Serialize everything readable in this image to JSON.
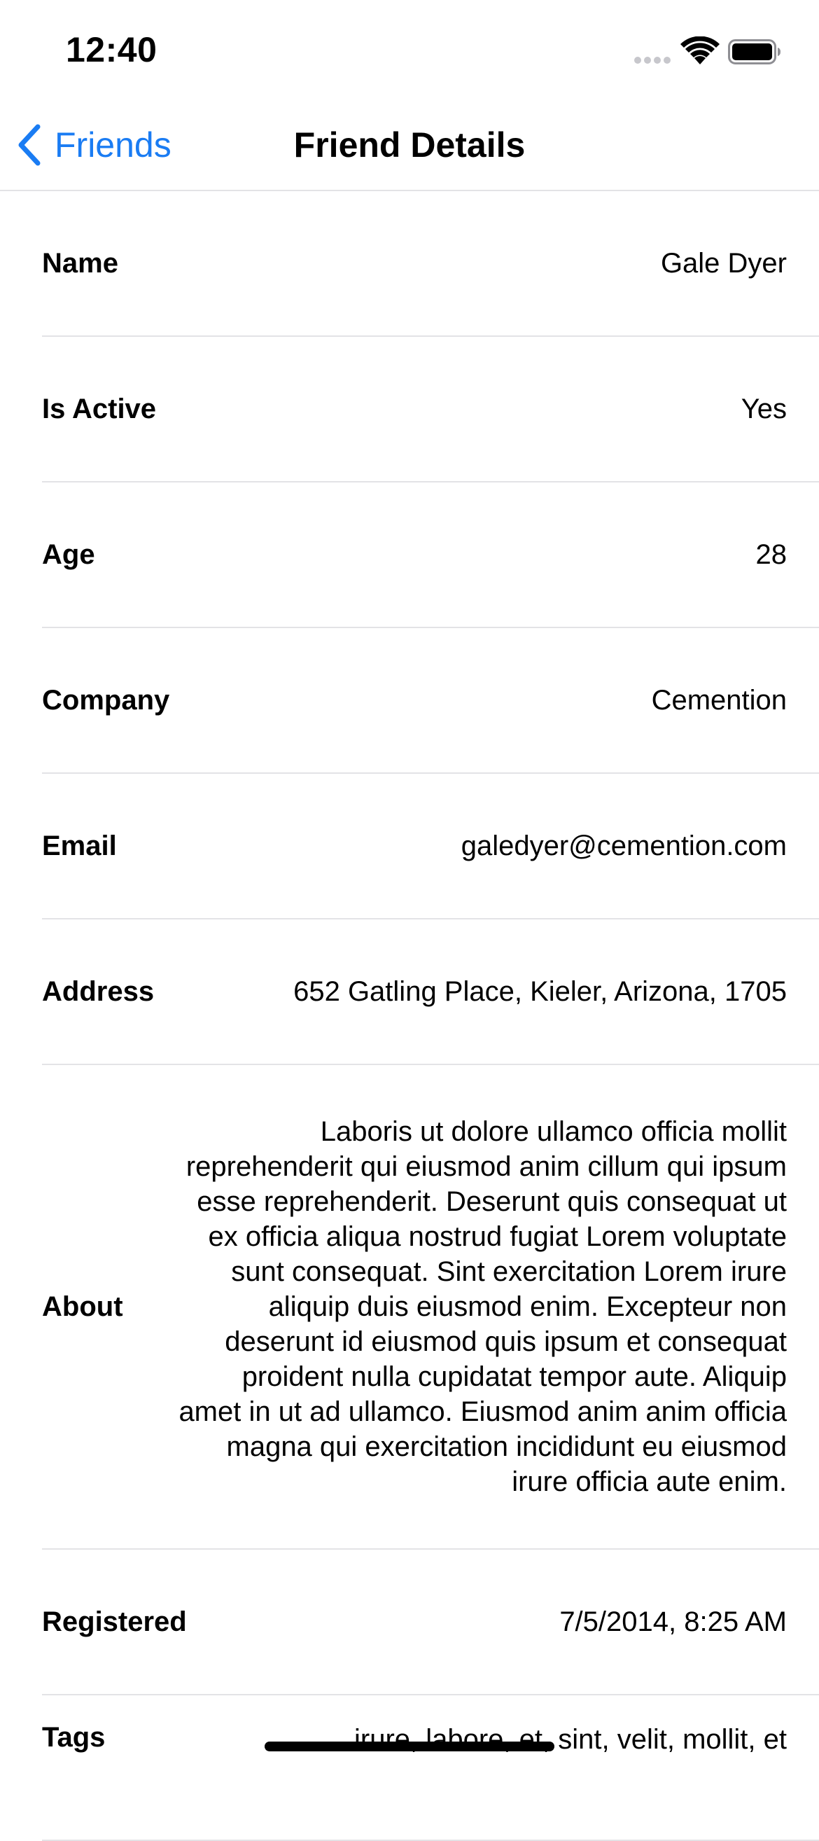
{
  "status_bar": {
    "time": "12:40"
  },
  "nav": {
    "back_label": "Friends",
    "title": "Friend Details"
  },
  "colors": {
    "accent": "#1a7cf3",
    "separator": "#e3e3e6"
  },
  "icons": [
    "signal-icon",
    "wifi-icon",
    "battery-icon",
    "chevron-left-icon"
  ],
  "rows": [
    {
      "label": "Name",
      "value": "Gale Dyer"
    },
    {
      "label": "Is Active",
      "value": "Yes"
    },
    {
      "label": "Age",
      "value": "28"
    },
    {
      "label": "Company",
      "value": "Cemention"
    },
    {
      "label": "Email",
      "value": "galedyer@cemention.com"
    },
    {
      "label": "Address",
      "value": "652 Gatling Place, Kieler, Arizona, 1705"
    },
    {
      "label": "About",
      "value": "Laboris ut dolore ullamco officia mollit reprehenderit qui eiusmod anim cillum qui ipsum esse reprehenderit. Deserunt quis consequat ut ex officia aliqua nostrud fugiat Lorem voluptate sunt consequat. Sint exercitation Lorem irure aliquip duis eiusmod enim. Excepteur non deserunt id eiusmod quis ipsum et consequat proident nulla cupidatat tempor aute. Aliquip amet in ut ad ullamco. Eiusmod anim anim officia magna qui exercitation incididunt eu eiusmod irure officia aute enim."
    },
    {
      "label": "Registered",
      "value": "7/5/2014, 8:25 AM"
    },
    {
      "label": "Tags",
      "value": "irure, labore, et, sint, velit, mollit, et"
    }
  ]
}
